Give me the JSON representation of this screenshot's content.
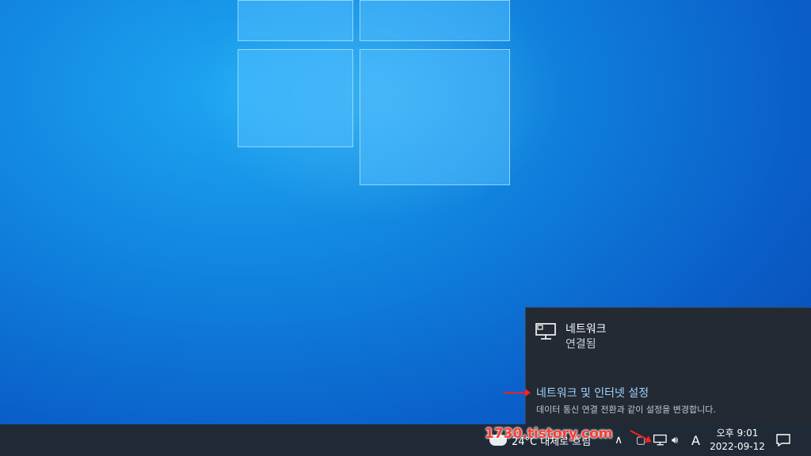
{
  "flyout": {
    "network_name": "네트워크",
    "network_status": "연결됨",
    "settings_link": "네트워크 및 인터넷 설정",
    "settings_desc": "데이터 통신 연결 전환과 같이 설정을 변경합니다."
  },
  "taskbar": {
    "weather_text": "24°C 대체로 흐림",
    "input_indicator": "A",
    "clock_time": "오후 9:01",
    "clock_date": "2022-09-12"
  },
  "watermark": "1730.tistory.com",
  "icons": {
    "network": "network-monitor-icon",
    "weather": "cloud-icon",
    "chevron": "chevron-up-icon",
    "volume": "speaker-icon",
    "notifications": "notification-icon"
  }
}
